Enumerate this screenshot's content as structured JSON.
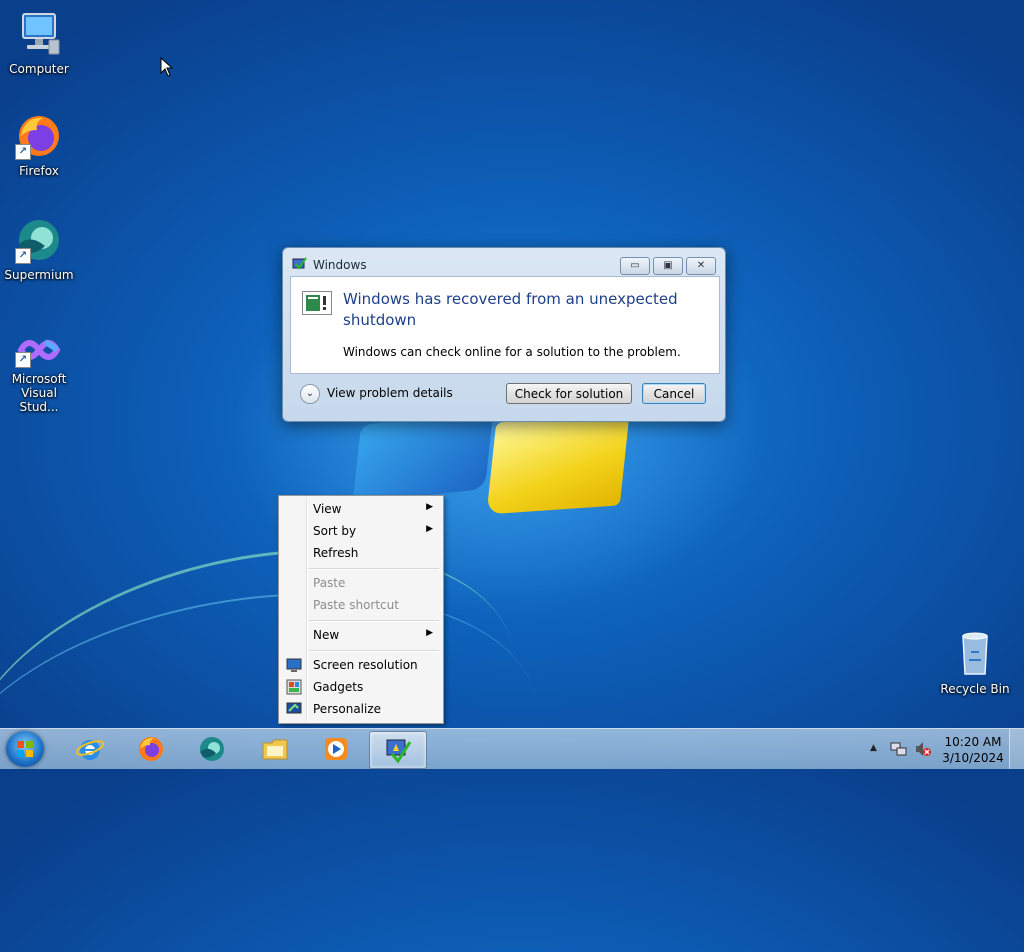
{
  "desktop": {
    "icons": [
      {
        "label": "Computer",
        "icon": "computer-icon"
      },
      {
        "label": "Firefox",
        "icon": "firefox-icon"
      },
      {
        "label": "Supermium",
        "icon": "supermium-icon"
      },
      {
        "label": "Microsoft Visual Stud...",
        "icon": "visual-studio-icon"
      },
      {
        "label": "Recycle Bin",
        "icon": "recycle-bin-icon"
      }
    ]
  },
  "dialog": {
    "title": "Windows",
    "heading": "Windows has recovered from an unexpected shutdown",
    "message": "Windows can check online for a solution to the problem.",
    "details_label": "View problem details",
    "check_label": "Check for solution",
    "cancel_label": "Cancel",
    "caption": {
      "minimize": "▭",
      "maximize": "▣",
      "close": "✕"
    }
  },
  "context_menu": {
    "items": [
      {
        "label": "View",
        "submenu": true,
        "enabled": true
      },
      {
        "label": "Sort by",
        "submenu": true,
        "enabled": true
      },
      {
        "label": "Refresh",
        "submenu": false,
        "enabled": true
      },
      {
        "label": "Paste",
        "submenu": false,
        "enabled": false
      },
      {
        "label": "Paste shortcut",
        "submenu": false,
        "enabled": false
      },
      {
        "label": "New",
        "submenu": true,
        "enabled": true
      },
      {
        "label": "Screen resolution",
        "submenu": false,
        "enabled": true,
        "icon": "screen-resolution-icon"
      },
      {
        "label": "Gadgets",
        "submenu": false,
        "enabled": true,
        "icon": "gadgets-icon"
      },
      {
        "label": "Personalize",
        "submenu": false,
        "enabled": true,
        "icon": "personalize-icon"
      }
    ],
    "arrow": "▶"
  },
  "taskbar": {
    "pinned": [
      "internet-explorer-icon",
      "firefox-icon",
      "supermium-icon",
      "file-explorer-icon",
      "media-player-icon",
      "action-center-icon"
    ],
    "tray_chevron": "▲",
    "time": "10:20 AM",
    "date": "3/10/2024"
  }
}
